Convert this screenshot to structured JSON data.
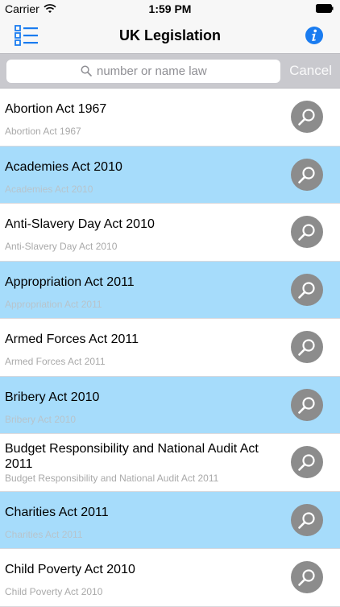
{
  "status_bar": {
    "carrier": "Carrier",
    "time": "1:59 PM"
  },
  "nav": {
    "title": "UK Legislation",
    "menu_icon": "list-icon",
    "info_icon": "info-icon"
  },
  "search": {
    "placeholder": "number or name law",
    "value": "",
    "cancel_label": "Cancel"
  },
  "laws": [
    {
      "title": "Abortion Act 1967",
      "subtitle": "Abortion Act 1967"
    },
    {
      "title": "Academies Act 2010",
      "subtitle": "Academies Act 2010"
    },
    {
      "title": "Anti-Slavery Day Act 2010",
      "subtitle": "Anti-Slavery Day Act 2010"
    },
    {
      "title": "Appropriation Act 2011",
      "subtitle": "Appropriation Act 2011"
    },
    {
      "title": "Armed Forces Act 2011",
      "subtitle": "Armed Forces Act 2011"
    },
    {
      "title": "Bribery Act 2010",
      "subtitle": "Bribery Act 2010"
    },
    {
      "title": "Budget Responsibility and National Audit Act 2011",
      "subtitle": "Budget Responsibility and National Audit Act 2011"
    },
    {
      "title": "Charities Act 2011",
      "subtitle": "Charities Act 2011"
    },
    {
      "title": "Child Poverty Act 2010",
      "subtitle": "Child Poverty Act 2010"
    }
  ],
  "colors": {
    "alt_row": "#a6dcfb",
    "accent": "#1a7cf0",
    "search_button": "#8c8c8c"
  }
}
